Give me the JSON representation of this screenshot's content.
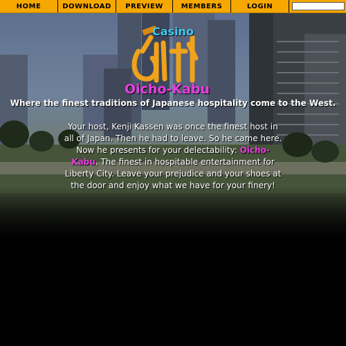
{
  "nav": {
    "items": [
      {
        "label": "HOME"
      },
      {
        "label": "DOWNLOAD"
      },
      {
        "label": "PREVIEW"
      },
      {
        "label": "MEMBERS"
      },
      {
        "label": "LOGIN"
      }
    ],
    "search": {
      "value": ""
    }
  },
  "logo": {
    "casino": "Casino",
    "name": "Oicho-Kabu"
  },
  "tagline": "Where the finest traditions of Japanese hospitality come to the West.",
  "body": {
    "part1": "Your host, Kenji Kassen was once the finest host in all of Japan.  Then he had to leave. So he came here.  Now he presents for your delectability: ",
    "highlight": "Oicho-Kabu",
    "part2": ".  The finest in hospitable entertainment for Liberty City. Leave your prejudice and your shoes at the door and enjoy what we have for your finery!"
  },
  "colors": {
    "nav_bg": "#f6a800",
    "casino_text": "#41c8ee",
    "brand_text": "#e83ee0",
    "logo_glyph": "#f0a21c"
  }
}
